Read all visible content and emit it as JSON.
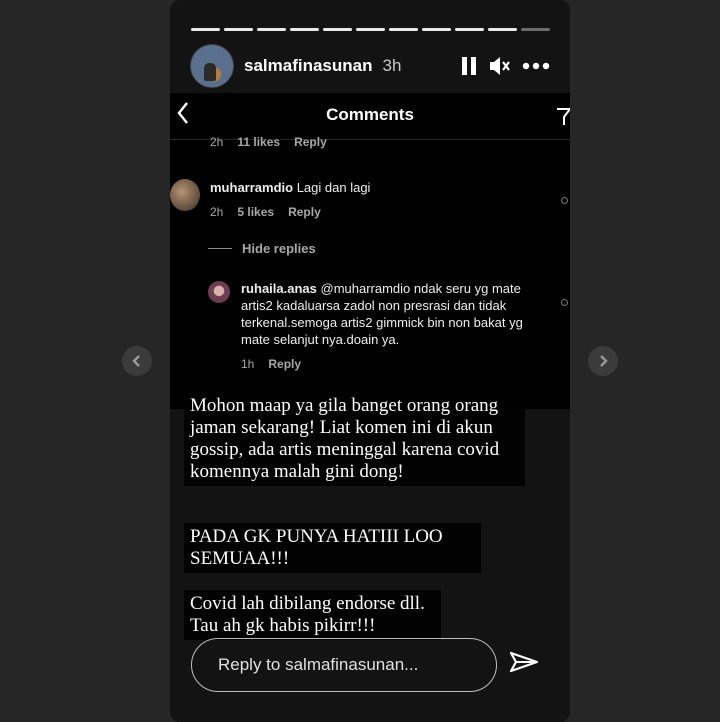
{
  "story": {
    "username": "salmafinasunan",
    "time": "3h",
    "progress_total": 11,
    "progress_filled": 10
  },
  "icons": [
    "pause-icon",
    "mute-icon",
    "more-icon",
    "back-chevron-icon",
    "filter-icon",
    "send-icon",
    "prev-arrow-icon",
    "next-arrow-icon"
  ],
  "comments_panel": {
    "title": "Comments",
    "top_meta": {
      "time": "2h",
      "likes": "11 likes",
      "reply": "Reply"
    },
    "comment": {
      "user": "muharramdio",
      "text": "Lagi dan lagi",
      "time": "2h",
      "likes": "5 likes",
      "reply": "Reply"
    },
    "hide_replies": "Hide replies",
    "reply": {
      "user": "ruhaila.anas",
      "text": "@muharramdio ndak seru yg mate artis2 kadaluarsa zadol non presrasi dan tidak terkenal.semoga artis2 gimmick bin non bakat yg mate selanjut nya.doain ya.",
      "time": "1h",
      "reply": "Reply"
    }
  },
  "overlay_text": {
    "block1": "Mohon maap ya gila banget orang orang jaman sekarang! Liat komen ini di akun gossip, ada artis meninggal karena covid komennya malah gini dong!",
    "block2": "PADA GK PUNYA HATIII LOO SEMUAA!!!",
    "block3": "Covid lah dibilang endorse dll. Tau ah gk habis pikirr!!!"
  },
  "reply_input": {
    "placeholder": "Reply to salmafinasunan..."
  }
}
